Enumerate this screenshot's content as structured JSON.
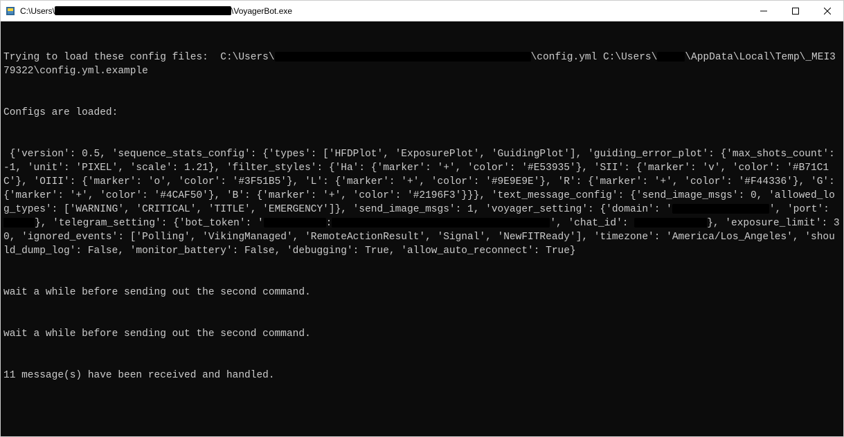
{
  "titlebar": {
    "prefix": "C:\\Users\\",
    "redact1_width": 255,
    "suffix": "\\VoyagerBot.exe"
  },
  "terminal": {
    "line1_a": "Trying to load these config files:  C:\\Users\\",
    "line1_b": "\\config.yml C:\\Users\\",
    "line1_c": "\\AppData\\Local\\Temp\\_MEI379322\\config.yml.example",
    "line2": "Configs are loaded:",
    "cfg_a": " {'version': 0.5, 'sequence_stats_config': {'types': ['HFDPlot', 'ExposurePlot', 'GuidingPlot'], 'guiding_error_plot': {'max_shots_count': -1, 'unit': 'PIXEL', 'scale': 1.21}, 'filter_styles': {'Ha': {'marker': '+', 'color': '#E53935'}, 'SII': {'marker': 'v', 'color': '#B71C1C'}, 'OIII': {'marker': 'o', 'color': '#3F51B5'}, 'L': {'marker': '+', 'color': '#9E9E9E'}, 'R': {'marker': '+', 'color': '#F44336'}, 'G': {'marker': '+', 'color': '#4CAF50'}, 'B': {'marker': '+', 'color': '#2196F3'}}}, 'text_message_config': {'send_image_msgs': 0, 'allowed_log_types': ['WARNING', 'CRITICAL', 'TITLE', 'EMERGENCY']}, 'send_image_msgs': 1, 'voyager_setting': {'domain': '",
    "cfg_b": "', 'port': ",
    "cfg_c": "}, 'telegram_setting': {'bot_token': '",
    "cfg_d": ":",
    "cfg_e": "', 'chat_id': ",
    "cfg_f": "}, 'exposure_limit': 30, 'ignored_events': ['Polling', 'VikingManaged', 'RemoteActionResult', 'Signal', 'NewFITReady'], 'timezone': 'America/Los_Angeles', 'should_dump_log': False, 'monitor_battery': False, 'debugging': True, 'allow_auto_reconnect': True}",
    "wait1": "wait a while before sending out the second command.",
    "wait2": "wait a while before sending out the second command.",
    "msgs": "11 message(s) have been received and handled."
  }
}
